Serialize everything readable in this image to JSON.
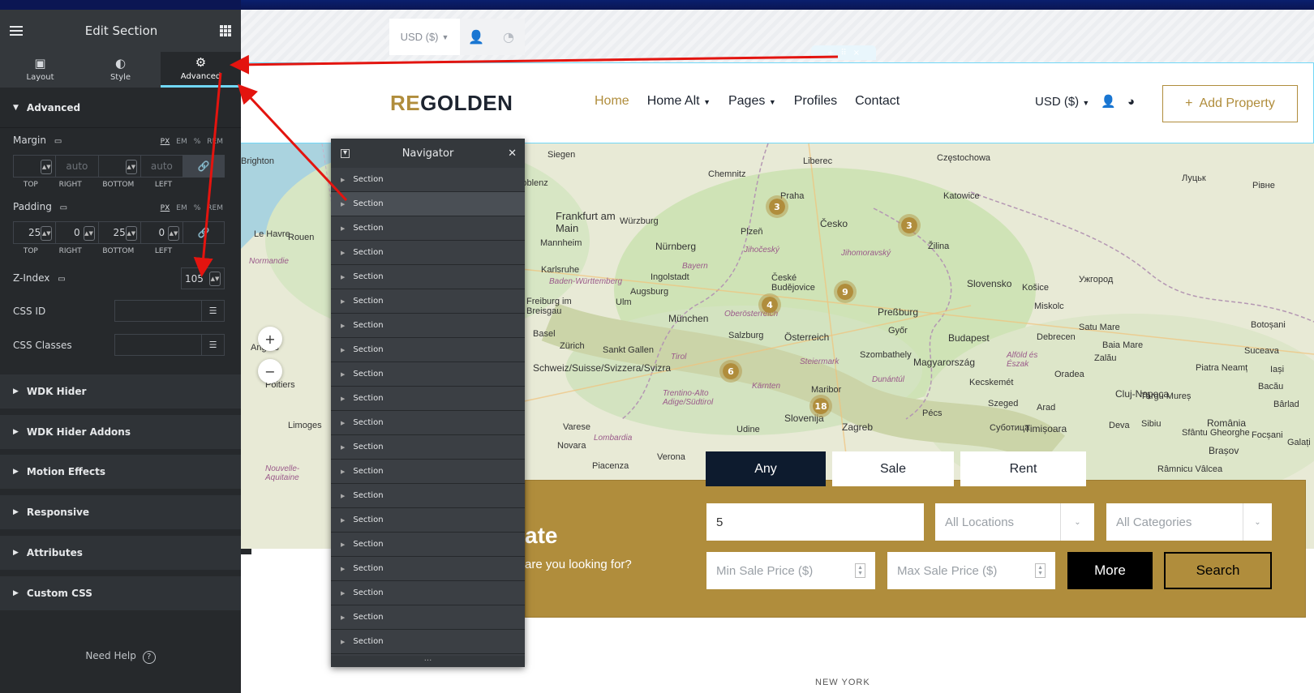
{
  "panel": {
    "title": "Edit Section",
    "tabs": [
      {
        "label": "Layout",
        "icon": "layout-icon"
      },
      {
        "label": "Style",
        "icon": "style-icon"
      },
      {
        "label": "Advanced",
        "icon": "gear-icon"
      }
    ],
    "section_title": "Advanced",
    "margin": {
      "label": "Margin",
      "units": [
        "PX",
        "EM",
        "%",
        "REM"
      ],
      "top": "",
      "right": "auto",
      "bottom": "",
      "left": "auto",
      "sub_labels": [
        "TOP",
        "RIGHT",
        "BOTTOM",
        "LEFT"
      ]
    },
    "padding": {
      "label": "Padding",
      "units": [
        "PX",
        "EM",
        "%",
        "REM"
      ],
      "top": "25",
      "right": "0",
      "bottom": "25",
      "left": "0",
      "sub_labels": [
        "TOP",
        "RIGHT",
        "BOTTOM",
        "LEFT"
      ]
    },
    "zindex": {
      "label": "Z-Index",
      "value": "105"
    },
    "css_id": {
      "label": "CSS ID",
      "value": ""
    },
    "css_classes": {
      "label": "CSS Classes",
      "value": ""
    },
    "accordions": [
      "WDK Hider",
      "WDK Hider Addons",
      "Motion Effects",
      "Responsive",
      "Attributes",
      "Custom CSS"
    ],
    "need_help": "Need Help"
  },
  "topbar": {
    "currency": "USD ($)"
  },
  "header": {
    "logo_re": "RE",
    "logo_golden": "GOLDEN",
    "nav": [
      "Home",
      "Home Alt",
      "Pages",
      "Profiles",
      "Contact"
    ],
    "currency": "USD ($)",
    "add_property": "Add Property"
  },
  "map": {
    "clusters": [
      "3",
      "3",
      "9",
      "4",
      "6",
      "18"
    ],
    "labels": [
      "Brighton",
      "Le Havre",
      "Rouen",
      "Normandie",
      "Angers",
      "Poitiers",
      "Limoges",
      "Nouvelle-Aquitaine",
      "Siegen",
      "Koblenz",
      "Frankfurt am Main",
      "Würzburg",
      "Mannheim",
      "Nürnberg",
      "Karlsruhe",
      "Ingolstadt",
      "Bayern",
      "Baden-Württemberg",
      "Augsburg",
      "Freiburg im Breisgau",
      "Ulm",
      "München",
      "Basel",
      "Zürich",
      "Sankt Gallen",
      "Schweiz/Suisse/Svizzera/Svizra",
      "Tirol",
      "Salzburg",
      "Trentino-Alto Adige/Südtirol",
      "Varese",
      "Novara",
      "Lombardia",
      "Verona",
      "Piacenza",
      "Chemnitz",
      "Praha",
      "Česko",
      "Plzeň",
      "Jihočeský",
      "České Budějovice",
      "Oberösterreich",
      "Österreich",
      "Steiermark",
      "Kärnten",
      "Udine",
      "Slovenija",
      "Zagreb",
      "Maribor",
      "Liberec",
      "Katowice",
      "Žilina",
      "Slovensko",
      "Košice",
      "Preßburg",
      "Győr",
      "Budapest",
      "Szombathely",
      "Magyarország",
      "Dunántúl",
      "Kecskemét",
      "Pécs",
      "Szeged",
      "Arad",
      "Timișoara",
      "Oradea",
      "Debrecen",
      "Miskolc",
      "Cluj-Napoca",
      "Târgu Mureș",
      "Sibiu",
      "România",
      "Brașov",
      "Deva",
      "Satu Mare",
      "Baia Mare",
      "Zalău",
      "Суботица",
      "Ужгород",
      "Рівне",
      "Луцьк",
      "Częstochowa",
      "Jihomoravský",
      "Alföld és Észak",
      "Piatra Neamț",
      "Iași",
      "Bacău",
      "Botoșani",
      "Suceava",
      "Bârlad",
      "Galați",
      "Focșani",
      "Râmnicu Vâlcea",
      "Sfântu Gheorghe"
    ]
  },
  "search": {
    "tabs": [
      "Any",
      "Sale",
      "Rent"
    ],
    "keyword": "5",
    "location": "All Locations",
    "category": "All Categories",
    "min_price": "Min Sale Price ($)",
    "max_price": "Max Sale Price ($)",
    "more": "More",
    "search": "Search",
    "heading_partial": "ate",
    "sub_partial": "are you looking for?"
  },
  "navigator": {
    "title": "Navigator",
    "items": [
      "Section",
      "Section",
      "Section",
      "Section",
      "Section",
      "Section",
      "Section",
      "Section",
      "Section",
      "Section",
      "Section",
      "Section",
      "Section",
      "Section",
      "Section",
      "Section",
      "Section",
      "Section",
      "Section",
      "Section"
    ]
  },
  "footer_label": "NEW YORK",
  "colors": {
    "accent": "#b08d3c",
    "panel_bg": "#26292c",
    "active_tab": "#71d7f7",
    "arrow": "#e3140f"
  }
}
